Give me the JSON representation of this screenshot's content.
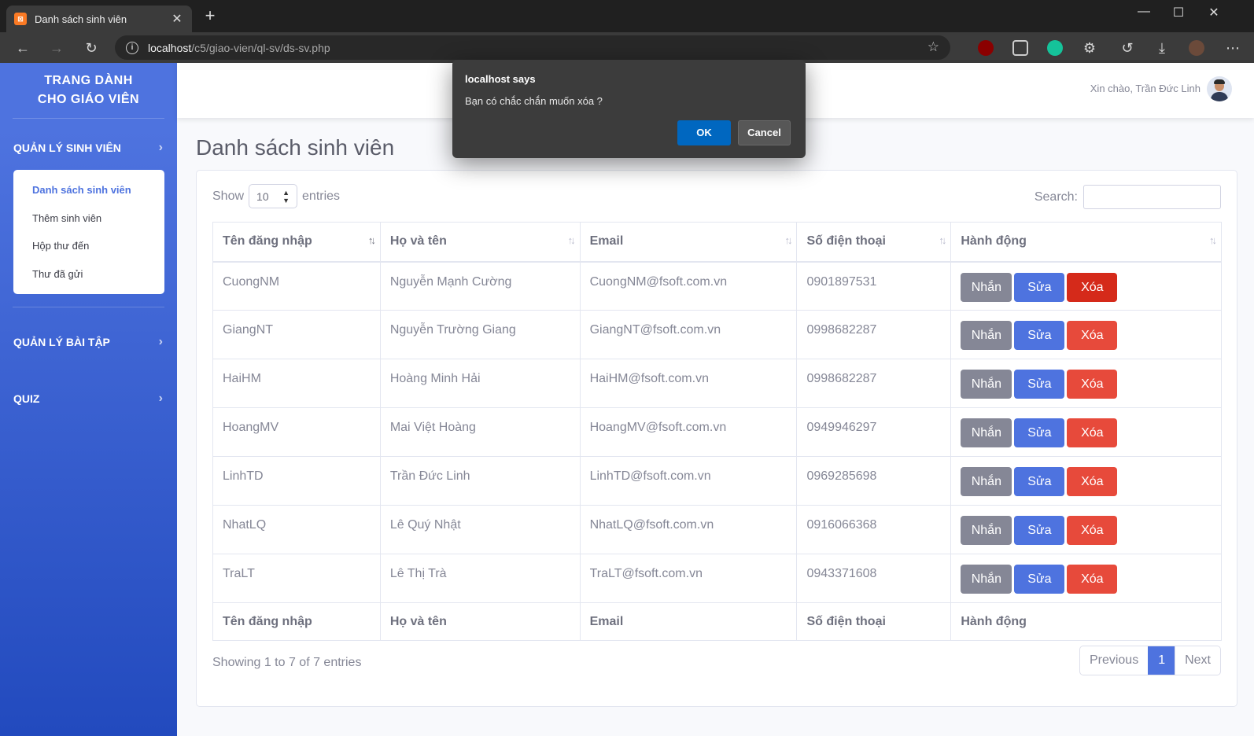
{
  "browser": {
    "tab_title": "Danh sách sinh viên",
    "tab_favicon": "xampp-icon",
    "url_host": "localhost",
    "url_path": "/c5/giao-vien/ql-sv/ds-sv.php"
  },
  "sidebar": {
    "brand_line1": "TRANG DÀNH",
    "brand_line2": "CHO GIÁO VIÊN",
    "sections": [
      {
        "label": "QUẢN LÝ SINH VIÊN"
      },
      {
        "label": "QUẢN LÝ BÀI TẬP"
      },
      {
        "label": "QUIZ"
      }
    ],
    "student_links": [
      {
        "label": "Danh sách sinh viên",
        "active": true
      },
      {
        "label": "Thêm sinh viên",
        "active": false
      },
      {
        "label": "Hộp thư đến",
        "active": false
      },
      {
        "label": "Thư đã gửi",
        "active": false
      }
    ]
  },
  "topbar": {
    "greeting": "Xin chào, Trần Đức Linh"
  },
  "page": {
    "title": "Danh sách sinh viên"
  },
  "table_controls": {
    "show_label": "Show",
    "page_size": "10",
    "entries_label": "entries",
    "search_label": "Search:",
    "search_value": ""
  },
  "table": {
    "columns": [
      "Tên đăng nhập",
      "Họ và tên",
      "Email",
      "Số điện thoại",
      "Hành động"
    ],
    "rows": [
      {
        "username": "CuongNM",
        "fullname": "Nguyễn Mạnh Cường",
        "email": "CuongNM@fsoft.com.vn",
        "phone": "0901897531"
      },
      {
        "username": "GiangNT",
        "fullname": "Nguyễn Trường Giang",
        "email": "GiangNT@fsoft.com.vn",
        "phone": "0998682287"
      },
      {
        "username": "HaiHM",
        "fullname": "Hoàng Minh Hải",
        "email": "HaiHM@fsoft.com.vn",
        "phone": "0998682287"
      },
      {
        "username": "HoangMV",
        "fullname": "Mai Việt Hoàng",
        "email": "HoangMV@fsoft.com.vn",
        "phone": "0949946297"
      },
      {
        "username": "LinhTD",
        "fullname": "Trần Đức Linh",
        "email": "LinhTD@fsoft.com.vn",
        "phone": "0969285698"
      },
      {
        "username": "NhatLQ",
        "fullname": "Lê Quý Nhật",
        "email": "NhatLQ@fsoft.com.vn",
        "phone": "0916066368"
      },
      {
        "username": "TraLT",
        "fullname": "Lê Thị Trà",
        "email": "TraLT@fsoft.com.vn",
        "phone": "0943371608"
      }
    ],
    "actions": {
      "message": "Nhắn",
      "edit": "Sửa",
      "delete": "Xóa"
    }
  },
  "footer": {
    "info": "Showing 1 to 7 of 7 entries",
    "previous": "Previous",
    "current_page": "1",
    "next": "Next"
  },
  "dialog": {
    "title": "localhost says",
    "message": "Bạn có chắc chắn muốn xóa ?",
    "ok": "OK",
    "cancel": "Cancel"
  },
  "colors": {
    "primary": "#4e73df",
    "danger": "#e74a3b",
    "secondary": "#858796",
    "dialog_ok": "#0067c0"
  }
}
